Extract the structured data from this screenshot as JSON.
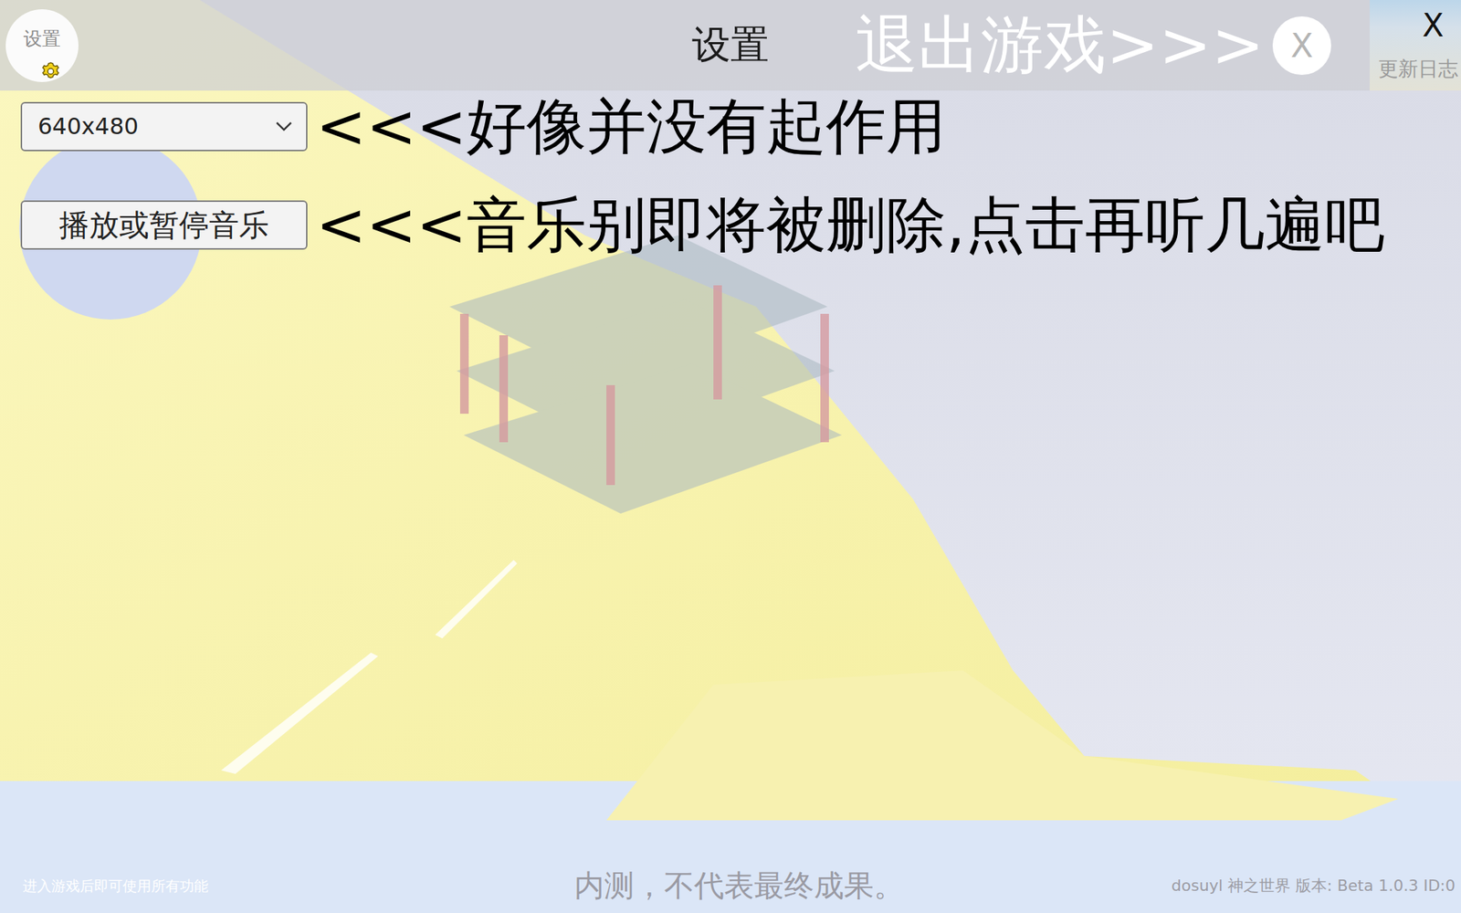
{
  "header": {
    "settings_button": "设置",
    "title": "设置",
    "exit_label": "退出游戏>>>",
    "exit_button": "X",
    "close_button": "X",
    "changelog": "更新日志"
  },
  "settings": [
    {
      "kind": "select",
      "value": "640x480",
      "note": "<<<好像并没有起作用"
    },
    {
      "kind": "button",
      "label": "播放或暂停音乐",
      "note": "<<<音乐别即将被删除,点击再听几遍吧"
    }
  ],
  "footer": {
    "hint": "进入游戏后即可使用所有功能",
    "notice": "内测，不代表最终成果。",
    "version": "dosuyl 神之世界 版本: Beta 1.0.3 ID:0"
  }
}
